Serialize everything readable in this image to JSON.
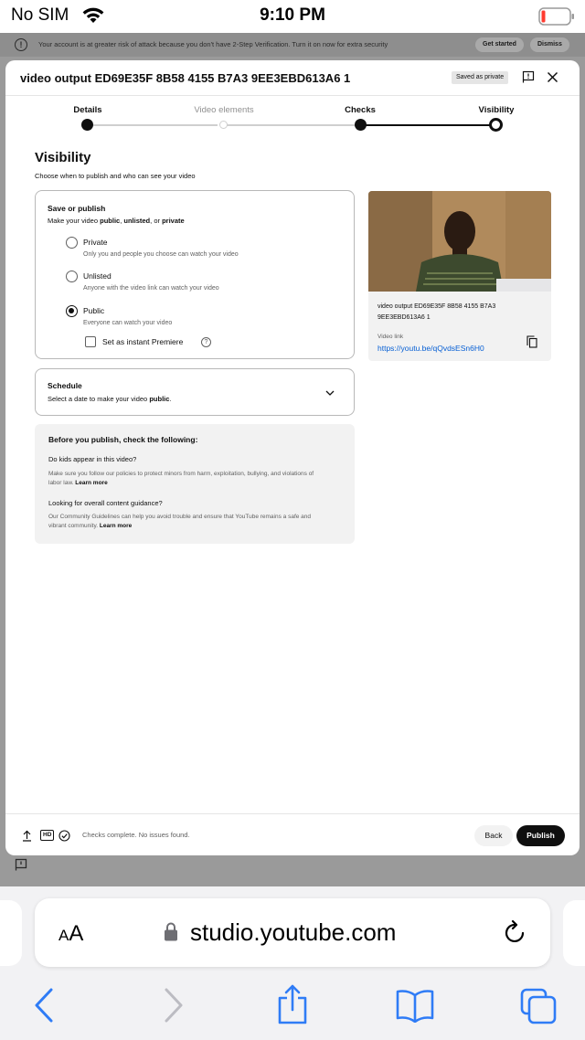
{
  "status_bar": {
    "carrier": "No SIM",
    "time": "9:10 PM"
  },
  "banner": {
    "text": "Your account is at greater risk of attack because you don't have 2-Step Verification. Turn it on now for extra security",
    "get_started": "Get started",
    "dismiss": "Dismiss"
  },
  "dialog": {
    "title": "video output ED69E35F 8B58 4155 B7A3 9EE3EBD613A6 1",
    "saved_badge": "Saved as private",
    "steps": [
      {
        "label": "Details",
        "state": "done"
      },
      {
        "label": "Video elements",
        "state": "pending"
      },
      {
        "label": "Checks",
        "state": "done"
      },
      {
        "label": "Visibility",
        "state": "current"
      }
    ],
    "section_title": "Visibility",
    "section_subtitle": "Choose when to publish and who can see your video",
    "save_publish": {
      "title": "Save or publish",
      "subtitle_prefix": "Make your video ",
      "subtitle_public": "public",
      "subtitle_sep1": ", ",
      "subtitle_unlisted": "unlisted",
      "subtitle_sep2": ", or ",
      "subtitle_private": "private",
      "options": [
        {
          "label": "Private",
          "description": "Only you and people you choose can watch your video",
          "selected": false
        },
        {
          "label": "Unlisted",
          "description": "Anyone with the video link can watch your video",
          "selected": false
        },
        {
          "label": "Public",
          "description": "Everyone can watch your video",
          "selected": true
        }
      ],
      "premiere_label": "Set as instant Premiere",
      "premiere_checked": false
    },
    "schedule": {
      "title": "Schedule",
      "subtitle_prefix": "Select a date to make your video ",
      "subtitle_bold": "public",
      "subtitle_suffix": "."
    },
    "checklist": {
      "title": "Before you publish, check the following:",
      "q1": "Do kids appear in this video?",
      "a1": "Make sure you follow our policies to protect minors from harm, exploitation, bullying, and violations of labor law.",
      "a1_link": "Learn more",
      "q2": "Looking for overall content guidance?",
      "a2": "Our Community Guidelines can help you avoid trouble and ensure that YouTube remains a safe and vibrant community.",
      "a2_link": "Learn more"
    },
    "preview": {
      "video_title_line1": "video output ED69E35F 8B58 4155 B7A3",
      "video_title_line2": "9EE3EBD613A6 1",
      "link_label": "Video link",
      "link": "https://youtu.be/qQvdsESn6H0"
    },
    "footer": {
      "hd_label": "HD",
      "checks_status": "Checks complete. No issues found.",
      "back": "Back",
      "publish": "Publish"
    }
  },
  "safari": {
    "aa_small": "A",
    "aa_large": "A",
    "url": "studio.youtube.com"
  },
  "colors": {
    "link": "#065fd4",
    "primary": "#0f0f0f",
    "backdrop": "#9a9a9a"
  }
}
